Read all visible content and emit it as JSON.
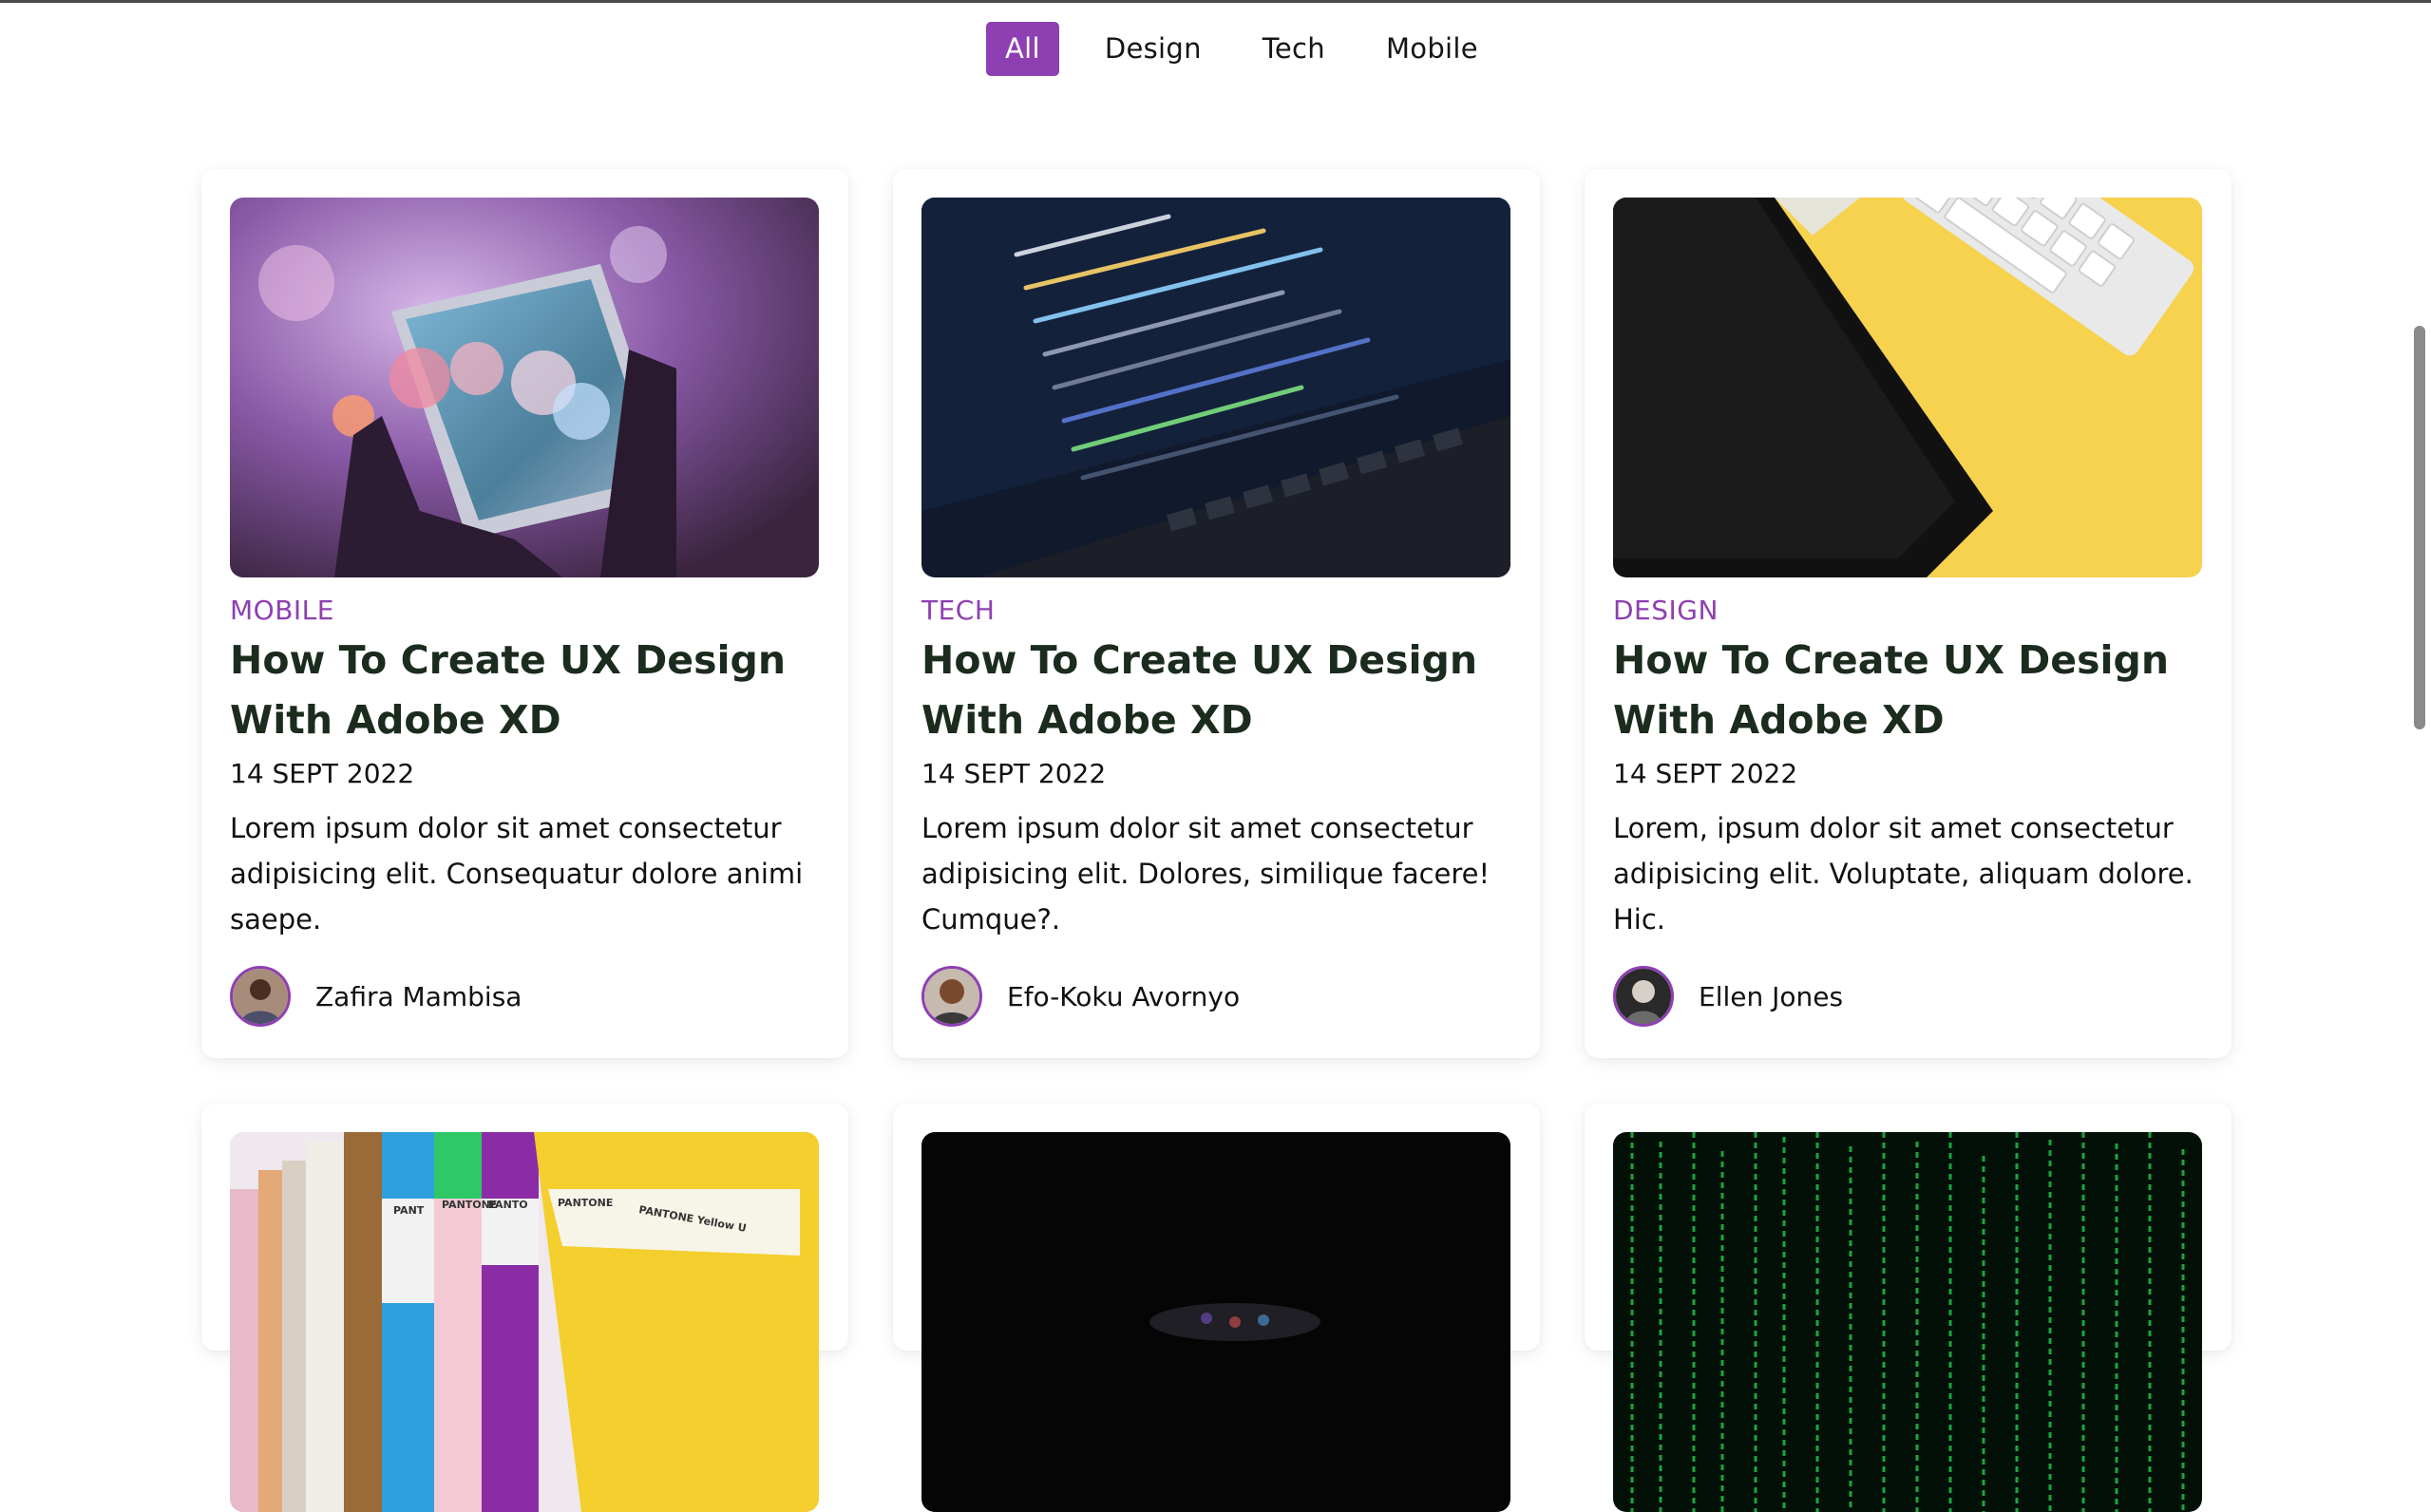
{
  "filters": [
    {
      "label": "All",
      "active": true
    },
    {
      "label": "Design",
      "active": false
    },
    {
      "label": "Tech",
      "active": false
    },
    {
      "label": "Mobile",
      "active": false
    }
  ],
  "posts": [
    {
      "category": "MOBILE",
      "title": "How To Create UX Design With Adobe XD",
      "date": "14 SEPT 2022",
      "excerpt": "Lorem ipsum dolor sit amet consectetur adipisicing elit. Consequatur dolore animi saepe.",
      "author": "Zafira Mambisa",
      "image": "phone-bokeh-photo"
    },
    {
      "category": "TECH",
      "title": "How To Create UX Design With Adobe XD",
      "date": "14 SEPT 2022",
      "excerpt": "Lorem ipsum dolor sit amet consectetur adipisicing elit. Dolores, similique facere! Cumque?.",
      "author": "Efo-Koku Avornyo",
      "image": "laptop-code-photo"
    },
    {
      "category": "DESIGN",
      "title": "How To Create UX Design With Adobe XD",
      "date": "14 SEPT 2022",
      "excerpt": "Lorem, ipsum dolor sit amet consectetur adipisicing elit. Voluptate, aliquam dolore. Hic.",
      "author": "Ellen Jones",
      "image": "tablet-keyboard-yellow-photo"
    },
    {
      "image": "pantone-swatches-photo",
      "swatch_labels": [
        "PANT",
        "PANTONE",
        "PANTO",
        "PANTONE",
        "PANTONE Yellow U"
      ]
    },
    {
      "image": "dark-phone-photo"
    },
    {
      "image": "matrix-code-photo"
    }
  ],
  "colors": {
    "accent": "#8e3fb2",
    "title": "#1b2b1d"
  }
}
